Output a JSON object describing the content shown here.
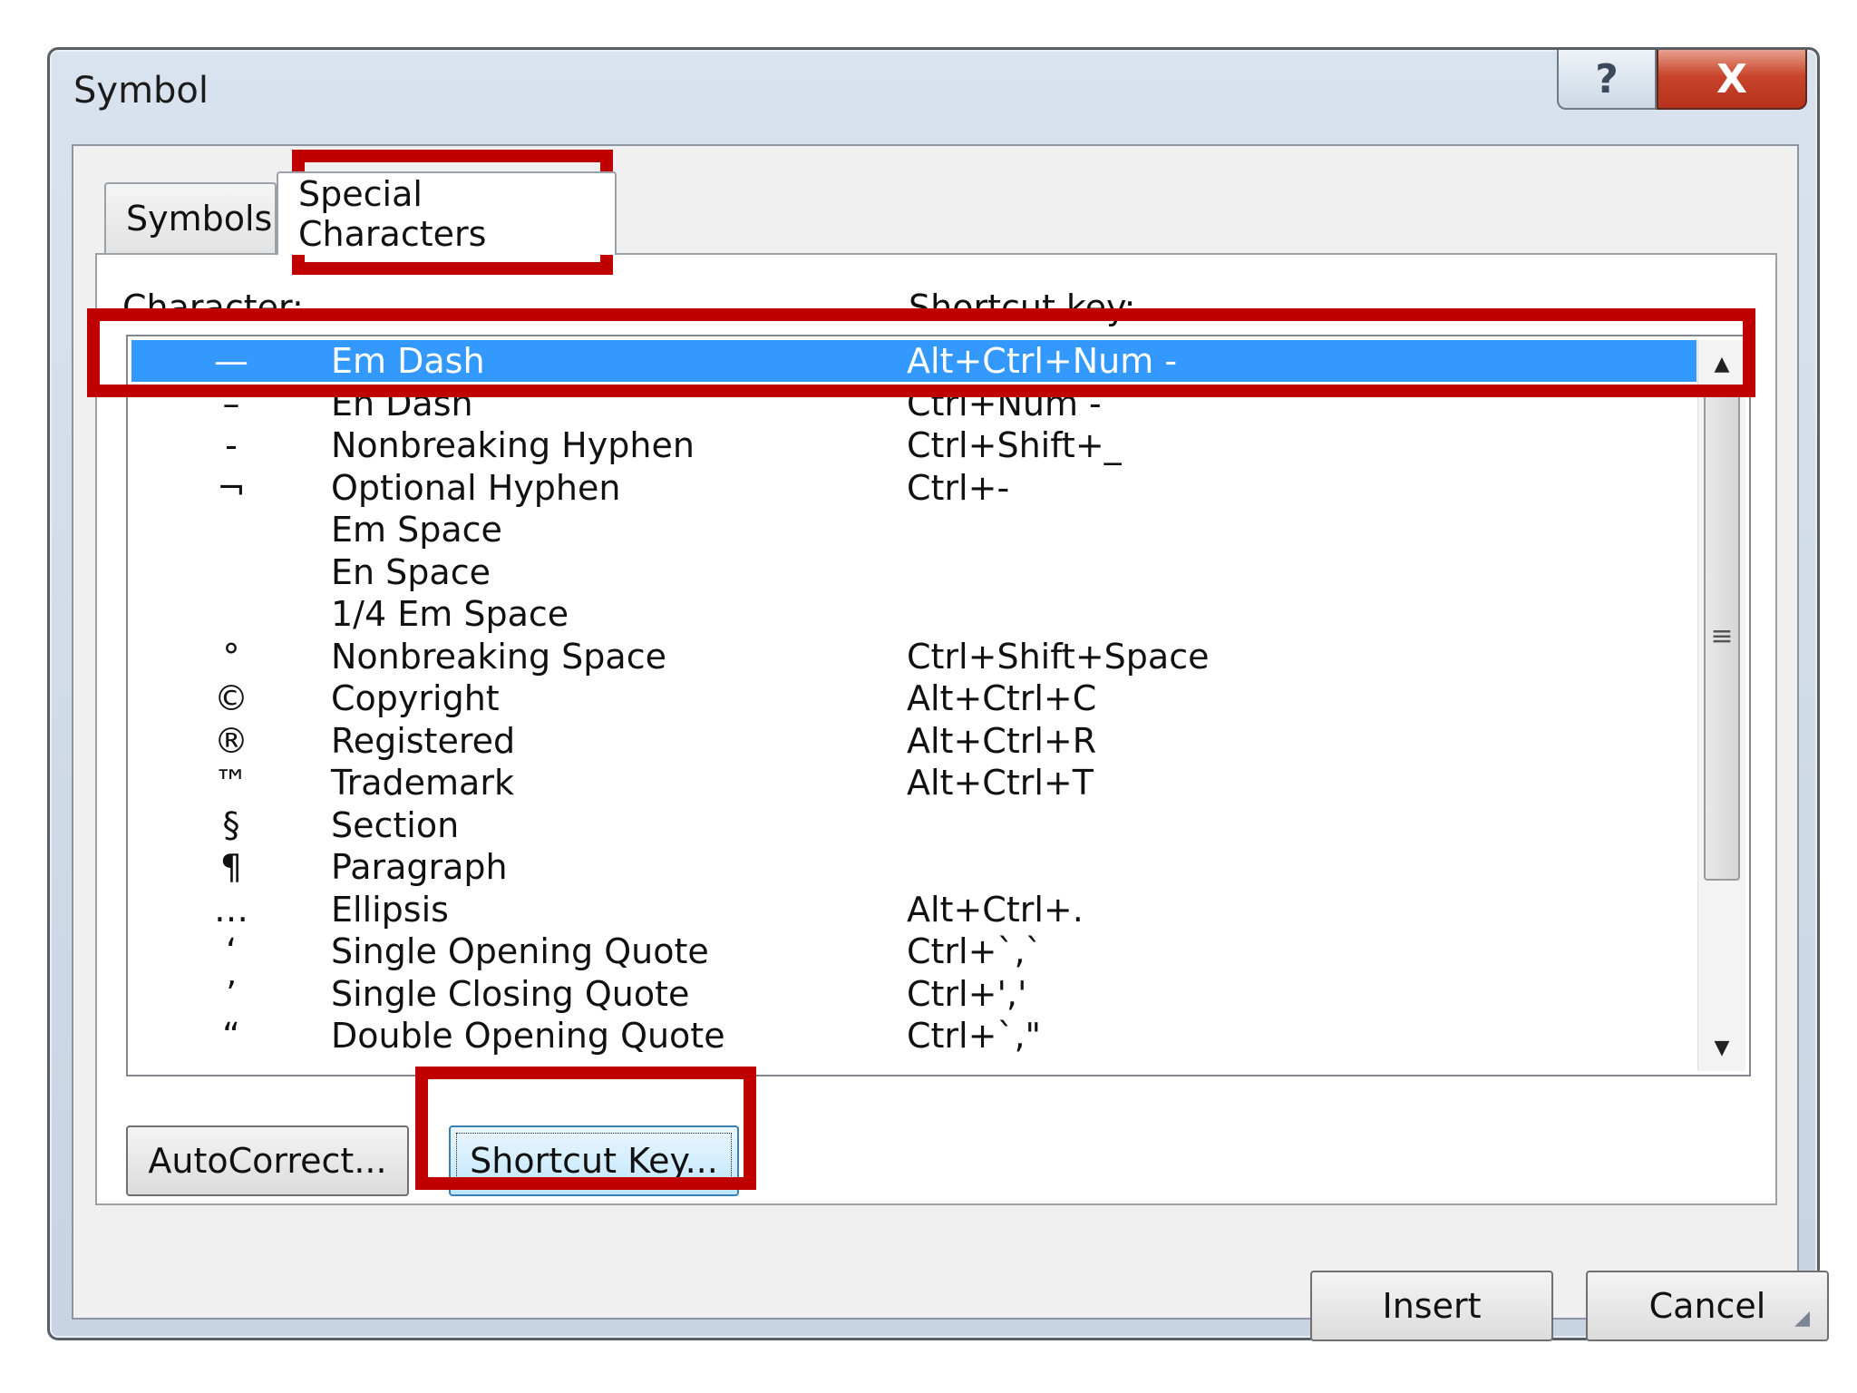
{
  "window": {
    "title": "Symbol",
    "help_label": "?",
    "close_label": "X"
  },
  "tabs": [
    {
      "label": "Symbols"
    },
    {
      "label": "Special Characters"
    }
  ],
  "columns": {
    "character": "Character:",
    "shortcut": "Shortcut key:"
  },
  "rows": [
    {
      "glyph": "—",
      "name": "Em Dash",
      "key": "Alt+Ctrl+Num -"
    },
    {
      "glyph": "–",
      "name": "En Dash",
      "key": "Ctrl+Num -"
    },
    {
      "glyph": "-",
      "name": "Nonbreaking Hyphen",
      "key": "Ctrl+Shift+_"
    },
    {
      "glyph": "¬",
      "name": "Optional Hyphen",
      "key": "Ctrl+-"
    },
    {
      "glyph": "",
      "name": "Em Space",
      "key": ""
    },
    {
      "glyph": "",
      "name": "En Space",
      "key": ""
    },
    {
      "glyph": "",
      "name": "1/4 Em Space",
      "key": ""
    },
    {
      "glyph": "°",
      "name": "Nonbreaking Space",
      "key": "Ctrl+Shift+Space"
    },
    {
      "glyph": "©",
      "name": "Copyright",
      "key": "Alt+Ctrl+C"
    },
    {
      "glyph": "®",
      "name": "Registered",
      "key": "Alt+Ctrl+R"
    },
    {
      "glyph": "™",
      "name": "Trademark",
      "key": "Alt+Ctrl+T"
    },
    {
      "glyph": "§",
      "name": "Section",
      "key": ""
    },
    {
      "glyph": "¶",
      "name": "Paragraph",
      "key": ""
    },
    {
      "glyph": "…",
      "name": "Ellipsis",
      "key": "Alt+Ctrl+."
    },
    {
      "glyph": "‘",
      "name": "Single Opening Quote",
      "key": "Ctrl+`,`"
    },
    {
      "glyph": "’",
      "name": "Single Closing Quote",
      "key": "Ctrl+','"
    },
    {
      "glyph": "“",
      "name": "Double Opening Quote",
      "key": "Ctrl+`,\""
    }
  ],
  "buttons": {
    "autocorrect": "AutoCorrect...",
    "shortcut": "Shortcut Key...",
    "insert": "Insert",
    "cancel": "Cancel"
  },
  "scrollbar": {
    "up_icon": "▲",
    "down_icon": "▼",
    "grip_icon": "≡"
  },
  "colors": {
    "selection": "#3399ff",
    "highlight": "#c00000"
  }
}
